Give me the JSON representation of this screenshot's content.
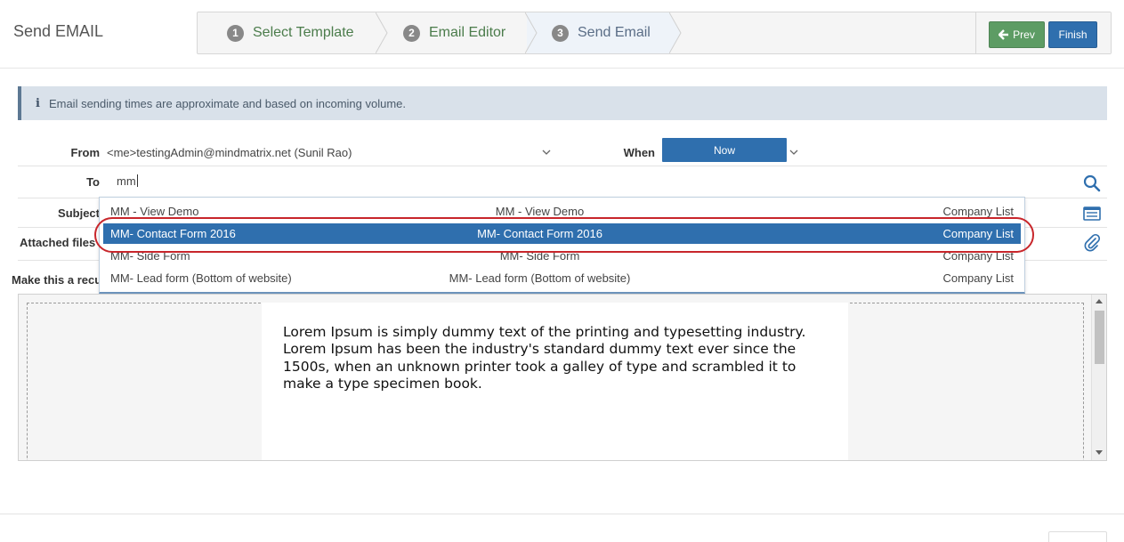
{
  "page": {
    "title": "Send EMAIL"
  },
  "wizard": {
    "steps": [
      {
        "num": "1",
        "label": "Select Template"
      },
      {
        "num": "2",
        "label": "Email Editor"
      },
      {
        "num": "3",
        "label": "Send Email"
      }
    ],
    "prev_label": "Prev",
    "finish_label": "Finish"
  },
  "info": {
    "icon": "info-icon",
    "text": "Email sending times are approximate and based on incoming volume."
  },
  "form": {
    "from_label": "From",
    "from_value": "<me>testingAdmin@mindmatrix.net (Sunil Rao)",
    "when_label": "When",
    "when_value": "Now",
    "to_label": "To",
    "to_value": "mm",
    "subject_label": "Subject",
    "attached_label": "Attached files",
    "recurring_label": "Make this a recurring email"
  },
  "dropdown": {
    "items": [
      {
        "name": "MM - View Demo",
        "detail": "MM - View Demo",
        "type": "Company List"
      },
      {
        "name": "MM- Contact Form 2016",
        "detail": "MM- Contact Form 2016",
        "type": "Company List"
      },
      {
        "name": "MM- Side Form",
        "detail": "MM- Side Form",
        "type": "Company List"
      },
      {
        "name": "MM- Lead form (Bottom of website)",
        "detail": "MM- Lead form (Bottom of website)",
        "type": "Company List"
      }
    ],
    "selected_index": 1
  },
  "editor": {
    "body_text": "Lorem Ipsum is simply dummy text of the printing and typesetting industry. Lorem Ipsum has been the industry's standard dummy text ever since the 1500s, when an unknown printer took a galley of type and scrambled it to make a type specimen book."
  },
  "colors": {
    "accent": "#2f6fae",
    "prev_button": "#5d9c64",
    "highlight_ring": "#c8262b"
  }
}
